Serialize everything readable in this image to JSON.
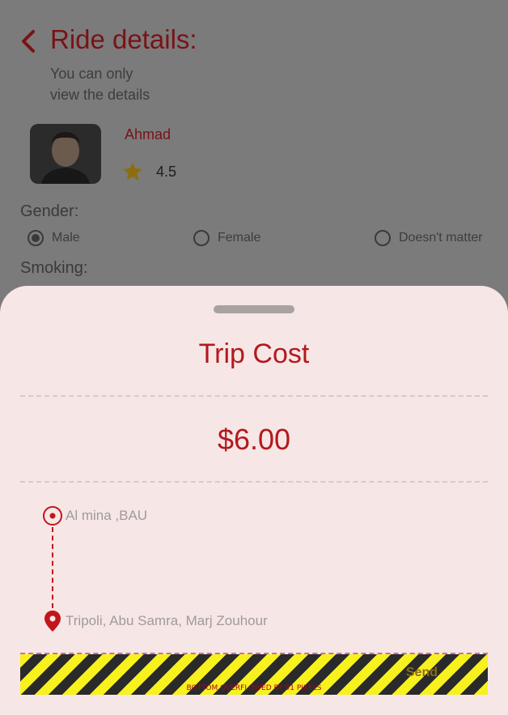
{
  "header": {
    "title": "Ride details:",
    "subtitle_line1": "You can only",
    "subtitle_line2": "view the details"
  },
  "driver": {
    "name": "Ahmad",
    "rating": "4.5",
    "avatar": "driver-photo",
    "rating_icon": "star-icon"
  },
  "preferences": {
    "gender_label": "Gender:",
    "gender_options": [
      "Male",
      "Female",
      "Doesn't matter"
    ],
    "gender_selected": "Male",
    "smoking_label": "Smoking:"
  },
  "sheet": {
    "title": "Trip Cost",
    "price": "$6.00",
    "pickup": "Al mina ,BAU",
    "destination": "Tripoli, Abu Samra, Marj Zouhour",
    "send_label": "Send",
    "overflow_warning": "BOTTOM OVERFLOWED BY 91 PIXELS"
  },
  "colors": {
    "accent": "#b3191d",
    "sheet_bg": "#f7e6e6",
    "overlay": "#7b7b7b"
  }
}
